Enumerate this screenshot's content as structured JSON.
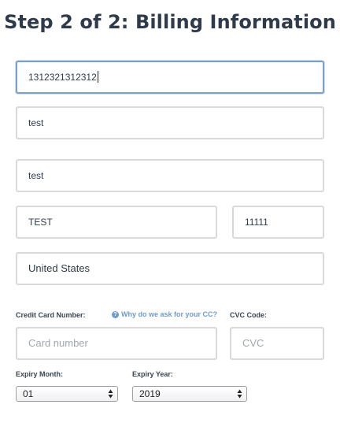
{
  "page_title": "Step 2 of 2: Billing Information",
  "fields": {
    "field1_value": "1312321312312",
    "field2_value": "test",
    "field3_value": "test",
    "city_value": "TEST",
    "zip_value": "11111",
    "country_value": "United States"
  },
  "card": {
    "number_label": "Credit Card Number:",
    "help_link": "Why do we ask for your CC?",
    "cvc_label": "CVC Code:",
    "number_placeholder": "Card number",
    "cvc_placeholder": "CVC"
  },
  "expiry": {
    "month_label": "Expiry Month:",
    "year_label": "Expiry Year:",
    "month_value": "01",
    "year_value": "2019"
  },
  "colors": {
    "title": "#2f3b4a",
    "focus_border": "#7aa2c8",
    "link": "#6f9bd1",
    "border": "#d9d9d9"
  }
}
